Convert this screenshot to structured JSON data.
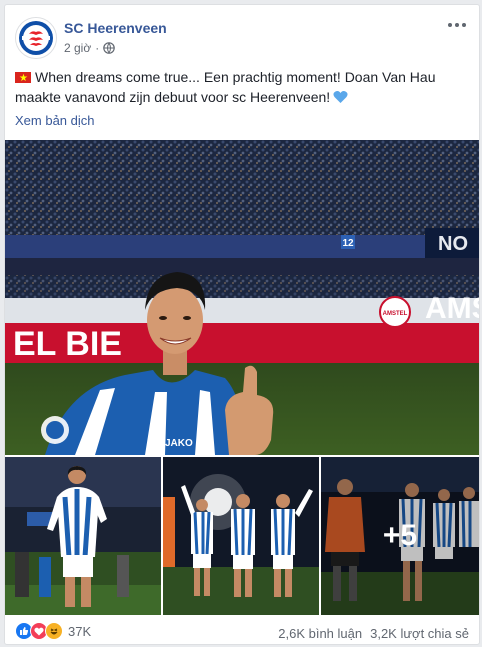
{
  "post": {
    "page_name": "SC Heerenveen",
    "time": "2 giờ",
    "text": "When dreams come true... Een prachtig moment! Doan Van Hau maakte vanavond zijn debuut voor sc Heerenveen!",
    "translate_link": "Xem bản dịch"
  },
  "photos": {
    "main": {
      "ad_board_left": "EL BIE",
      "ad_board_right": "AMS",
      "stand_number": "12",
      "stand_sign": "NO",
      "sleeve": "JAKO",
      "amstel": "AMSTEL"
    },
    "more_count": "+5"
  },
  "footer": {
    "reactions_count": "37K",
    "comments": "2,6K bình luận",
    "shares": "3,2K lượt chia sẻ"
  },
  "colors": {
    "link": "#385898",
    "like": "#1877f2",
    "love": "#f33e58",
    "haha": "#f7b125"
  }
}
